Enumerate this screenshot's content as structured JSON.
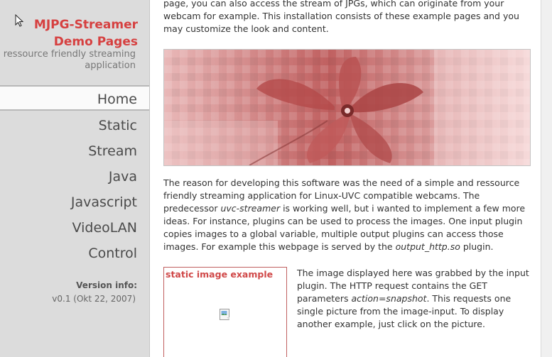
{
  "sidebar": {
    "title": "MJPG-Streamer\nDemo Pages",
    "subtitle": "a ressource friendly streaming\napplication",
    "nav": [
      {
        "label": "Home",
        "active": true
      },
      {
        "label": "Static",
        "active": false
      },
      {
        "label": "Stream",
        "active": false
      },
      {
        "label": "Java",
        "active": false
      },
      {
        "label": "Javascript",
        "active": false
      },
      {
        "label": "VideoLAN",
        "active": false
      },
      {
        "label": "Control",
        "active": false
      }
    ],
    "version_label": "Version info:",
    "version_value": "v0.1 (Okt 22, 2007)"
  },
  "content": {
    "intro_text": "page, you can also access the stream of JPGs, which can originate from your webcam for example. This installation consists of these example pages and you may customize the look and content.",
    "reason_parts": {
      "p1": "The reason for developing this software was the need of a simple and ressource friendly streaming application for Linux-UVC compatible webcams. The predecessor ",
      "em1": "uvc-streamer",
      "p2": " is working well, but i wanted to implement a few more ideas. For instance, plugins can be used to process the images. One input plugin copies images to a global variable, multiple output plugins can access those images. For example this webpage is served by the ",
      "em2": "output_http.so",
      "p3": " plugin."
    },
    "static_box_title": "static image example",
    "side_parts": {
      "p1": "The image displayed here was grabbed by the input plugin. The HTTP request contains the GET parameters ",
      "em1": "action=snapshot",
      "p2": ". This requests one single picture from the image-input. To display another example, just click on the picture."
    }
  },
  "colors": {
    "accent": "#d64040",
    "sidebar_bg": "#dcdcdc",
    "banner_tint": "#c86060"
  },
  "icons": {
    "cursor": "mouse-pointer-icon",
    "broken_image": "broken-image-icon"
  }
}
